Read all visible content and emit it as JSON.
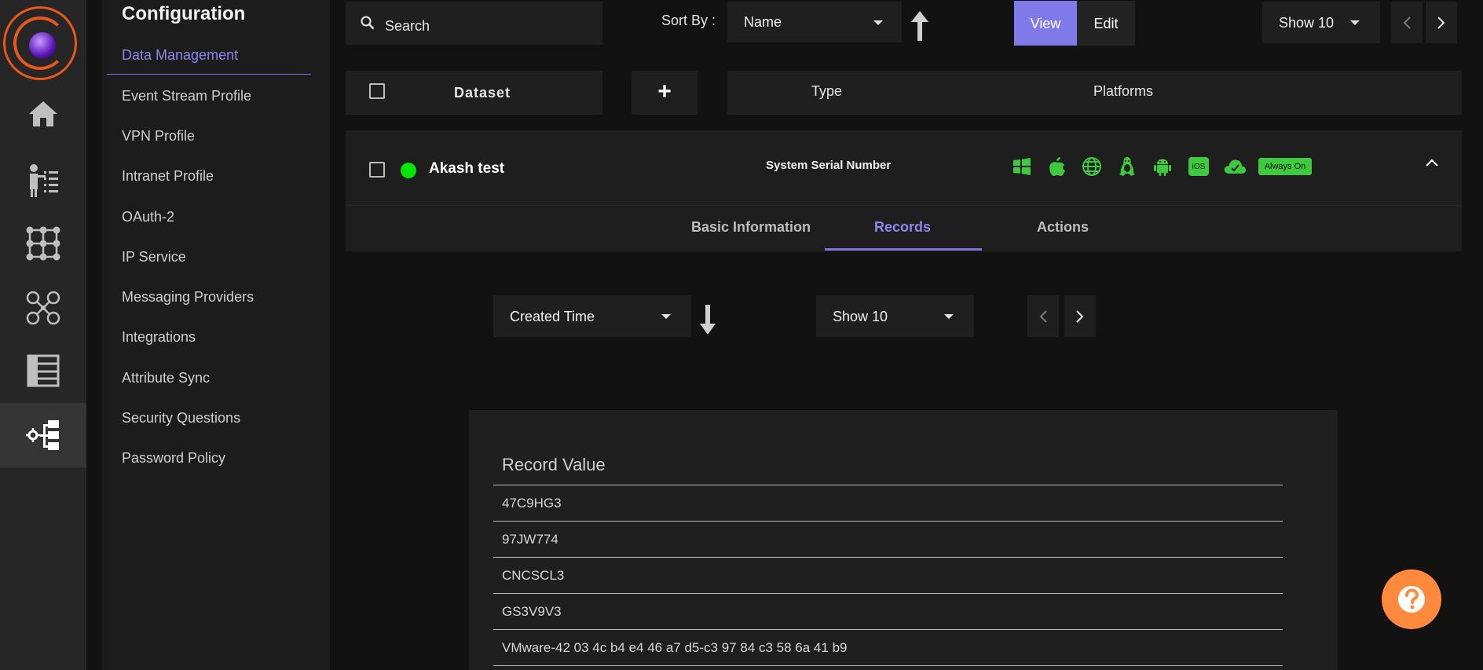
{
  "sidebar": {
    "title": "Configuration",
    "items": [
      {
        "label": "Data Management",
        "active": true
      },
      {
        "label": "Event Stream Profile"
      },
      {
        "label": "VPN Profile"
      },
      {
        "label": "Intranet Profile"
      },
      {
        "label": "OAuth-2"
      },
      {
        "label": "IP Service"
      },
      {
        "label": "Messaging Providers"
      },
      {
        "label": "Integrations"
      },
      {
        "label": "Attribute Sync"
      },
      {
        "label": "Security Questions"
      },
      {
        "label": "Password Policy"
      }
    ]
  },
  "rail": {
    "icons": [
      "logo",
      "home-icon",
      "user-list-icon",
      "grid-nodes-icon",
      "user-network-icon",
      "table-icon",
      "settings-tree-icon"
    ],
    "active": "settings-tree-icon"
  },
  "toolbar": {
    "search_placeholder": "Search",
    "sort_by_label": "Sort By :",
    "sort_value": "Name",
    "view_label": "View",
    "edit_label": "Edit",
    "show_value": "Show 10"
  },
  "table_header": {
    "dataset": "Dataset",
    "add": "+",
    "type": "Type",
    "platforms": "Platforms"
  },
  "dataset_row": {
    "name": "Akash test",
    "type": "System Serial Number",
    "status_color": "#00e600",
    "platform_icons": [
      "windows-icon",
      "apple-icon",
      "web-icon",
      "linux-icon",
      "android-icon",
      "ios-icon",
      "cloud-icon"
    ],
    "ios_label": "iOS",
    "always_on_label": "Always On"
  },
  "tabs": {
    "items": [
      "Basic Information",
      "Records",
      "Actions"
    ],
    "active": "Records"
  },
  "records_controls": {
    "sort_value": "Created Time",
    "show_value": "Show 10"
  },
  "records": {
    "header": "Record Value",
    "rows": [
      "47C9HG3",
      "97JW774",
      "CNCSCL3",
      "GS3V9V3",
      "VMware-42 03 4c b4 e4 46 a7 d5-c3 97 84 c3 58 6a 41 b9"
    ]
  },
  "colors": {
    "accent": "#7b74e0",
    "platform_green": "#3ec93e",
    "help_orange": "#ff8a3d"
  }
}
